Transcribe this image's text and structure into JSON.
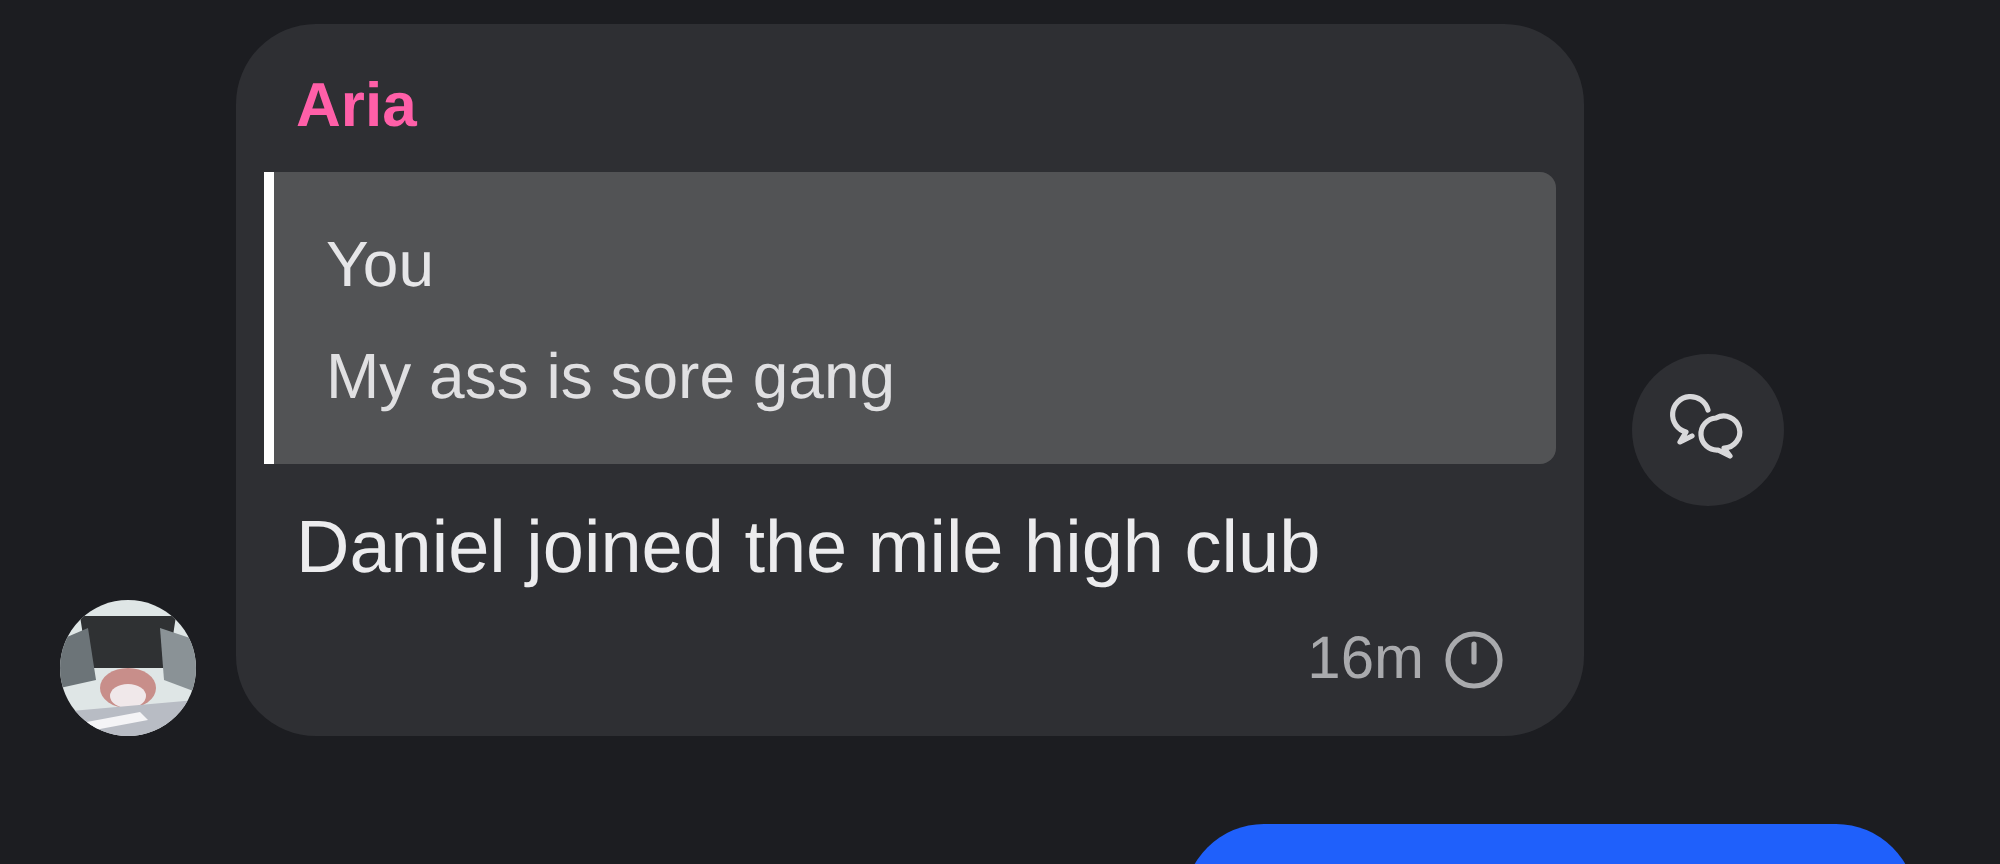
{
  "message": {
    "sender": {
      "name": "Aria",
      "color": "#ff5fa8"
    },
    "quote": {
      "author": "You",
      "text": "My ass is sore gang"
    },
    "text": "Daniel joined the mile high club",
    "time": "16m"
  }
}
